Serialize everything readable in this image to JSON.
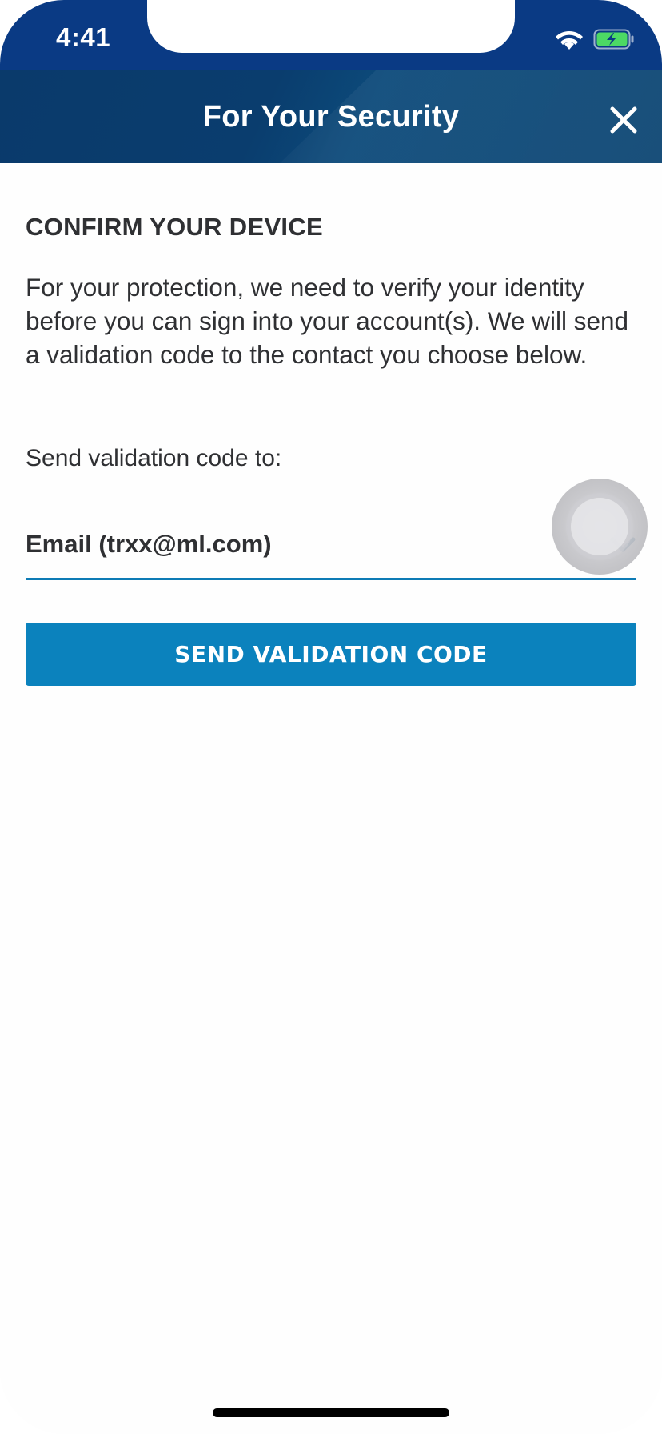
{
  "status_bar": {
    "time": "4:41",
    "wifi_icon": "wifi-icon",
    "battery_icon": "battery-charging-icon",
    "battery_color": "#4cd964"
  },
  "header": {
    "title": "For Your Security",
    "close_icon": "close-icon",
    "background": "#0a3d6e"
  },
  "content": {
    "section_title": "CONFIRM YOUR DEVICE",
    "description": "For your protection, we need to verify your identity before you can sign into your account(s). We will send a validation code to the contact you choose below.",
    "send_to_label": "Send validation code to:",
    "contact_select": {
      "selected_value": "Email (trxx@ml.com)",
      "icon": "chevron-down-icon"
    },
    "send_button_label": "SEND VALIDATION CODE",
    "accent_color": "#0b82bd"
  }
}
